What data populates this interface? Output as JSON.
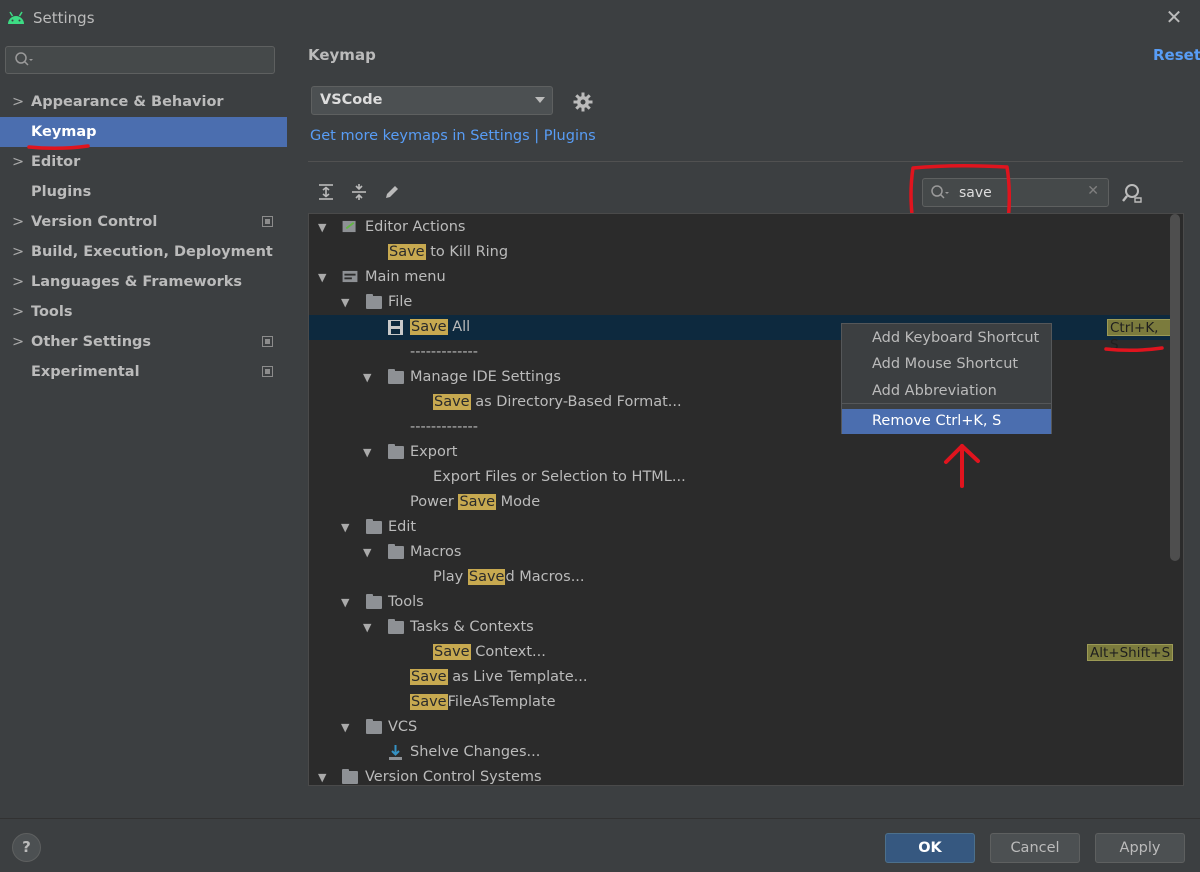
{
  "window": {
    "title": "Settings",
    "close": "✕"
  },
  "sidebar": {
    "search_placeholder": "",
    "items": [
      {
        "label": "Appearance & Behavior"
      },
      {
        "label": "Keymap"
      },
      {
        "label": "Editor"
      },
      {
        "label": "Plugins"
      },
      {
        "label": "Version Control"
      },
      {
        "label": "Build, Execution, Deployment"
      },
      {
        "label": "Languages & Frameworks"
      },
      {
        "label": "Tools"
      },
      {
        "label": "Other Settings"
      },
      {
        "label": "Experimental"
      }
    ]
  },
  "main": {
    "title": "Keymap",
    "reset_label": "Reset",
    "keymap_selected": "VSCode",
    "more_link_prefix": "Get more keymaps in Settings | Plugins",
    "search": {
      "value": "save",
      "clear": "✕"
    }
  },
  "tree": {
    "rows": [
      {
        "pre": "",
        "hl": "",
        "post": "Editor Actions"
      },
      {
        "pre": "",
        "hl": "Save",
        "post": " to Kill Ring"
      },
      {
        "pre": "",
        "hl": "",
        "post": "Main menu"
      },
      {
        "pre": "",
        "hl": "",
        "post": "File"
      },
      {
        "pre": "",
        "hl": "Save",
        "post": " All",
        "shortcut": "Ctrl+K, S"
      },
      {
        "pre": "",
        "hl": "",
        "post": "-------------"
      },
      {
        "pre": "",
        "hl": "",
        "post": "Manage IDE Settings"
      },
      {
        "pre": "",
        "hl": "Save",
        "post": " as Directory-Based Format..."
      },
      {
        "pre": "",
        "hl": "",
        "post": "-------------"
      },
      {
        "pre": "",
        "hl": "",
        "post": "Export"
      },
      {
        "pre": "",
        "hl": "",
        "post": "Export Files or Selection to HTML..."
      },
      {
        "pre": "Power ",
        "hl": "Save",
        "post": " Mode"
      },
      {
        "pre": "",
        "hl": "",
        "post": "Edit"
      },
      {
        "pre": "",
        "hl": "",
        "post": "Macros"
      },
      {
        "pre": "Play ",
        "hl": "Save",
        "post": "d Macros..."
      },
      {
        "pre": "",
        "hl": "",
        "post": "Tools"
      },
      {
        "pre": "",
        "hl": "",
        "post": "Tasks & Contexts"
      },
      {
        "pre": "",
        "hl": "Save",
        "post": " Context...",
        "shortcut": "Alt+Shift+S"
      },
      {
        "pre": "",
        "hl": "Save",
        "post": " as Live Template..."
      },
      {
        "pre": "",
        "hl": "Save",
        "post": "FileAsTemplate"
      },
      {
        "pre": "",
        "hl": "",
        "post": "VCS"
      },
      {
        "pre": "",
        "hl": "",
        "post": "Shelve Changes..."
      },
      {
        "pre": "",
        "hl": "",
        "post": "Version Control Systems"
      }
    ]
  },
  "context_menu": {
    "items": [
      {
        "label": "Add Keyboard Shortcut"
      },
      {
        "label": "Add Mouse Shortcut"
      },
      {
        "label": "Add Abbreviation"
      },
      {
        "label": "Remove Ctrl+K, S"
      }
    ]
  },
  "footer": {
    "help": "?",
    "ok": "OK",
    "cancel": "Cancel",
    "apply": "Apply"
  },
  "colors": {
    "accent": "#4b6eaf",
    "link": "#589df6",
    "highlight": "#c7a950",
    "annotation": "#e0141e"
  }
}
